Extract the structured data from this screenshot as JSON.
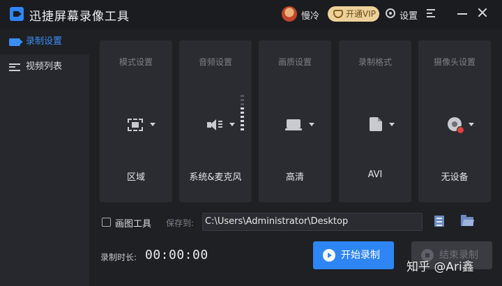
{
  "window": {
    "title": "迅捷屏幕录像工具",
    "username": "慢冷",
    "vip_label": "开通VIP",
    "settings_label": "设置"
  },
  "sidebar": {
    "items": [
      {
        "label": "录制设置",
        "icon": "record-icon",
        "active": true
      },
      {
        "label": "视频列表",
        "icon": "video-list-icon",
        "active": false
      }
    ]
  },
  "cards": [
    {
      "title": "模式设置",
      "value": "区域",
      "icon": "region-select-icon"
    },
    {
      "title": "音频设置",
      "value": "系统&麦克风",
      "icon": "speaker-icon"
    },
    {
      "title": "画质设置",
      "value": "高清",
      "icon": "monitor-icon"
    },
    {
      "title": "录制格式",
      "value": "AVI",
      "icon": "file-icon"
    },
    {
      "title": "摄像头设置",
      "value": "无设备",
      "icon": "webcam-icon"
    }
  ],
  "options": {
    "draw_tool_label": "画图工具",
    "draw_tool_checked": false,
    "save_to_label": "保存到:",
    "save_path": "C:\\Users\\Administrator\\Desktop"
  },
  "recording": {
    "duration_label": "录制时长:",
    "duration_value": "00:00:00",
    "start_label": "开始录制",
    "stop_label": "结束录制"
  },
  "watermark": "知乎 @Ari鑫",
  "colors": {
    "accent": "#2e86f4",
    "background": "#1f2024",
    "sidebar": "#27282d",
    "card": "#2b2c31",
    "vip": "#ecd29a"
  }
}
